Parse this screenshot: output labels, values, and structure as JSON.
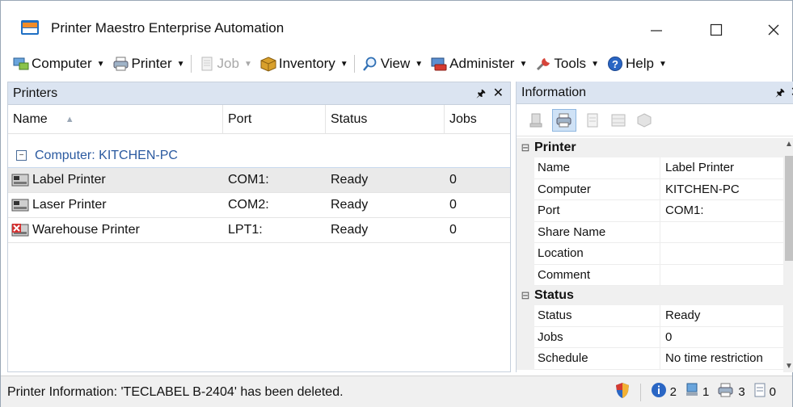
{
  "window": {
    "title": "Printer Maestro Enterprise Automation",
    "icons": {
      "minimize": "minimize-icon",
      "maximize": "maximize-icon",
      "close": "close-icon"
    }
  },
  "menubar": {
    "items": [
      {
        "label": "Computer",
        "icon": "computer-icon",
        "enabled": true
      },
      {
        "label": "Printer",
        "icon": "printer-icon",
        "enabled": true
      },
      {
        "label": "Job",
        "icon": "job-icon",
        "enabled": false
      },
      {
        "label": "Inventory",
        "icon": "inventory-icon",
        "enabled": true
      },
      {
        "label": "View",
        "icon": "magnifier-icon",
        "enabled": true
      },
      {
        "label": "Administer",
        "icon": "administer-icon",
        "enabled": true
      },
      {
        "label": "Tools",
        "icon": "tools-icon",
        "enabled": true
      },
      {
        "label": "Help",
        "icon": "help-icon",
        "enabled": true
      }
    ]
  },
  "printers_pane": {
    "title": "Printers",
    "columns": {
      "name": "Name",
      "port": "Port",
      "status": "Status",
      "jobs": "Jobs"
    },
    "group_label": "Computer: KITCHEN-PC",
    "rows": [
      {
        "name": "Label Printer",
        "port": "COM1:",
        "status": "Ready",
        "jobs": "0",
        "selected": true,
        "error": false
      },
      {
        "name": "Laser Printer",
        "port": "COM2:",
        "status": "Ready",
        "jobs": "0",
        "selected": false,
        "error": false
      },
      {
        "name": "Warehouse Printer",
        "port": "LPT1:",
        "status": "Ready",
        "jobs": "0",
        "selected": false,
        "error": true
      }
    ]
  },
  "info_pane": {
    "title": "Information",
    "categories": [
      {
        "name": "Printer",
        "props": [
          {
            "key": "Name",
            "value": "Label Printer"
          },
          {
            "key": "Computer",
            "value": "KITCHEN-PC"
          },
          {
            "key": "Port",
            "value": "COM1:"
          },
          {
            "key": "Share Name",
            "value": ""
          },
          {
            "key": "Location",
            "value": ""
          },
          {
            "key": "Comment",
            "value": ""
          }
        ]
      },
      {
        "name": "Status",
        "props": [
          {
            "key": "Status",
            "value": "Ready"
          },
          {
            "key": "Jobs",
            "value": "0"
          },
          {
            "key": "Schedule",
            "value": "No time restriction"
          }
        ]
      }
    ]
  },
  "statusbar": {
    "message": "Printer Information: 'TECLABEL B-2404' has been deleted.",
    "counts": {
      "info": "2",
      "computers": "1",
      "printers": "3",
      "jobs": "0"
    }
  },
  "colors": {
    "accent": "#2b5aa0",
    "pane_header": "#dbe4f1",
    "selected_row": "#eaeaea"
  }
}
